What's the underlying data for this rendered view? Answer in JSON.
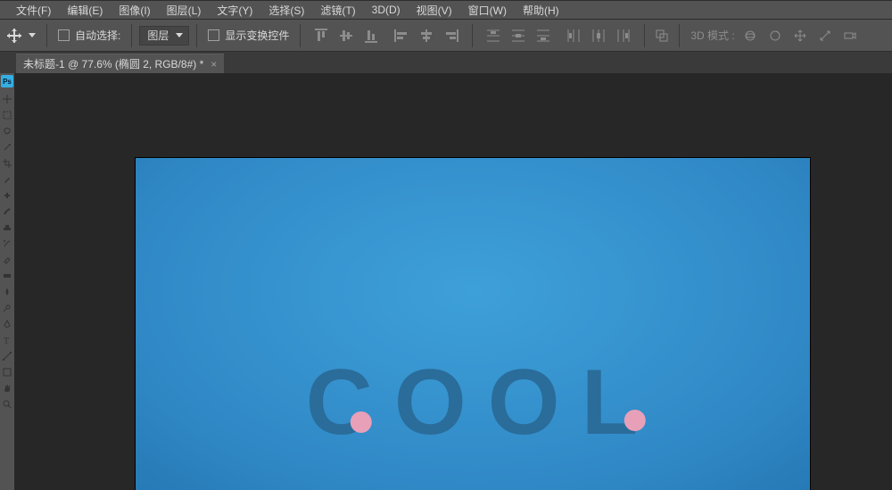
{
  "menu": {
    "file": "文件(F)",
    "edit": "编辑(E)",
    "image": "图像(I)",
    "layer": "图层(L)",
    "type": "文字(Y)",
    "select": "选择(S)",
    "filter": "滤镜(T)",
    "3d": "3D(D)",
    "view": "视图(V)",
    "window": "窗口(W)",
    "help": "帮助(H)"
  },
  "options": {
    "auto_select_label": "自动选择:",
    "auto_select_checked": false,
    "target_select_value": "图层",
    "show_transform_label": "显示变换控件",
    "show_transform_checked": false,
    "mode3d_label": "3D 模式 :"
  },
  "tab": {
    "title": "未标题-1 @ 77.6% (椭圆 2, RGB/8#) *"
  },
  "canvas": {
    "text": "COOL",
    "chars": [
      "C",
      "O",
      "O",
      "L"
    ]
  },
  "icons": {
    "move": "move-icon",
    "chevron_down": "chevron-down-icon",
    "checkbox": "checkbox-icon",
    "align_top": "align-top-icon",
    "align_vcenter": "align-vcenter-icon",
    "align_bottom": "align-bottom-icon",
    "align_left": "align-left-icon",
    "align_hcenter": "align-hcenter-icon",
    "align_right": "align-right-icon",
    "dist_top": "distribute-top-icon",
    "dist_vcenter": "distribute-vcenter-icon",
    "dist_bottom": "distribute-bottom-icon",
    "dist_left": "distribute-left-icon",
    "dist_hcenter": "distribute-hcenter-icon",
    "dist_right": "distribute-right-icon",
    "overlap": "overlap-icon",
    "orbit": "orbit-3d-icon",
    "pan": "pan-3d-icon",
    "slide": "slide-3d-icon",
    "rotate": "rotate-3d-icon",
    "camera": "camera-3d-icon",
    "close": "close-icon",
    "ps": "ps-logo"
  },
  "colors": {
    "ui_bg": "#535353",
    "canvas_bg": "#272727",
    "accent": "#35aee2",
    "text": "#d8d8d8",
    "artboard_blue": "#3089c6",
    "cool_text": "#2a6c9a",
    "pink": "#e8a0b8"
  }
}
